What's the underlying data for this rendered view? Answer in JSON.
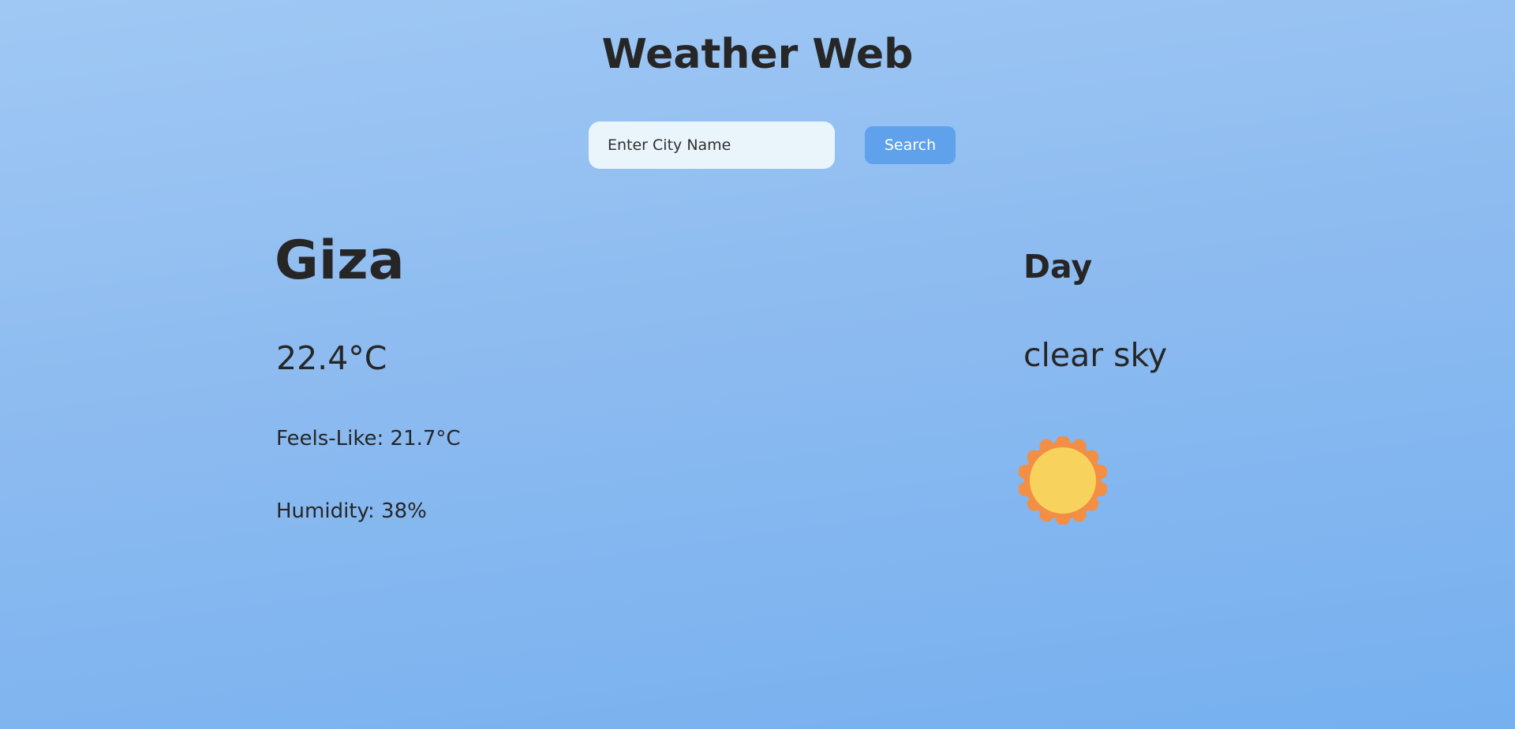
{
  "header": {
    "title": "Weather Web"
  },
  "search": {
    "placeholder": "Enter City Name",
    "value": "",
    "button_label": "Search"
  },
  "weather": {
    "city": "Giza",
    "temperature": "22.4°C",
    "feels_like": "Feels-Like: 21.7°C",
    "humidity": "Humidity: 38%",
    "time_of_day": "Day",
    "description": "clear sky",
    "icon": "sun-icon"
  },
  "colors": {
    "background_top": "#a0c8f4",
    "background_bottom": "#76b0ef",
    "search_button": "#60a1ec",
    "input_background": "#eaf4fb",
    "sun_core": "#f7d35e",
    "sun_rays": "#f28f45",
    "text": "#262626"
  }
}
